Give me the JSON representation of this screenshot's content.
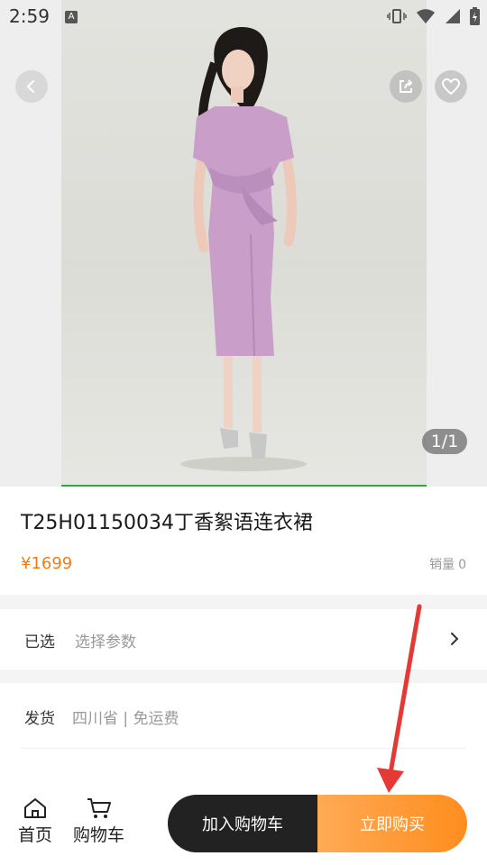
{
  "status_bar": {
    "time": "2:59",
    "notification_badge": "A",
    "icons": [
      "vibrate-icon",
      "wifi-icon",
      "signal-icon",
      "battery-icon"
    ]
  },
  "gallery": {
    "page_indicator": "1/1",
    "buttons": [
      "back-icon",
      "share-icon",
      "heart-icon"
    ]
  },
  "product": {
    "title": "T25H01150034丁香絮语连衣裙",
    "price": "¥1699",
    "sales_label": "销量",
    "sales_count": "0"
  },
  "options": {
    "selected_label": "已选",
    "selected_value": "选择参数",
    "ship_label": "发货",
    "ship_value": "四川省 | 免运费"
  },
  "bottom_nav": {
    "home_label": "首页",
    "cart_label": "购物车",
    "add_to_cart": "加入购物车",
    "buy_now": "立即购买"
  },
  "colors": {
    "accent": "#f07c10",
    "buy_button": "#ff8d1e",
    "cart_button": "#222222",
    "annotation_arrow": "#e53935"
  }
}
